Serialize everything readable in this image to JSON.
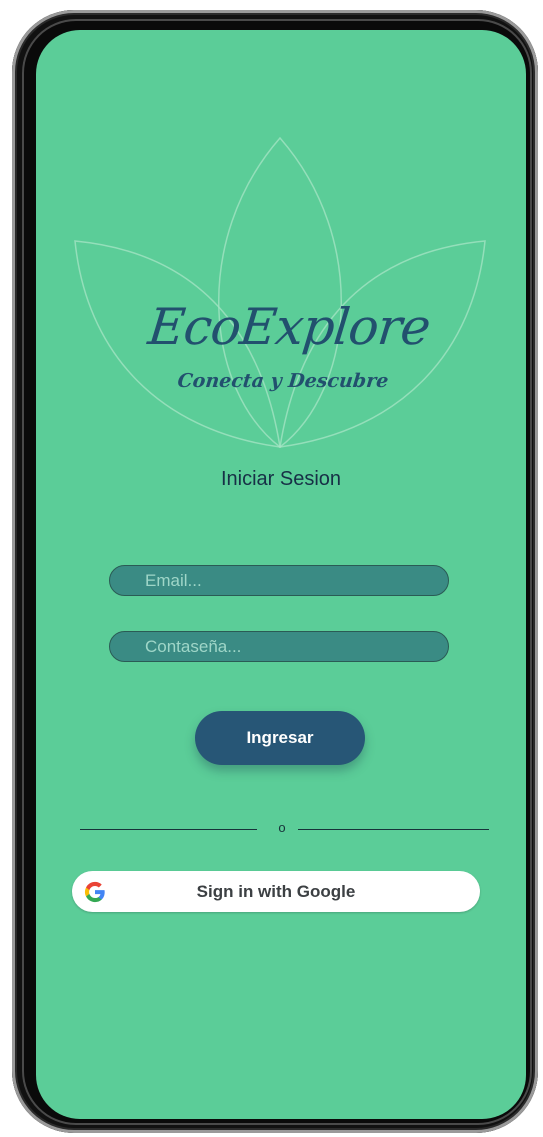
{
  "app": {
    "title": "EcoExplore",
    "subtitle": "Conecta y Descubre"
  },
  "login": {
    "heading": "Iniciar Sesion",
    "email_placeholder": "Email...",
    "password_placeholder": "Contaseña...",
    "submit_label": "Ingresar",
    "divider_text": "o",
    "google_label": "Sign in with Google"
  },
  "colors": {
    "background": "#5bcd98",
    "field": "#3a8b84",
    "primary": "#275676",
    "logo_text": "#22506e"
  },
  "icons": {
    "logo": "leaf-icon",
    "google": "google-icon"
  }
}
